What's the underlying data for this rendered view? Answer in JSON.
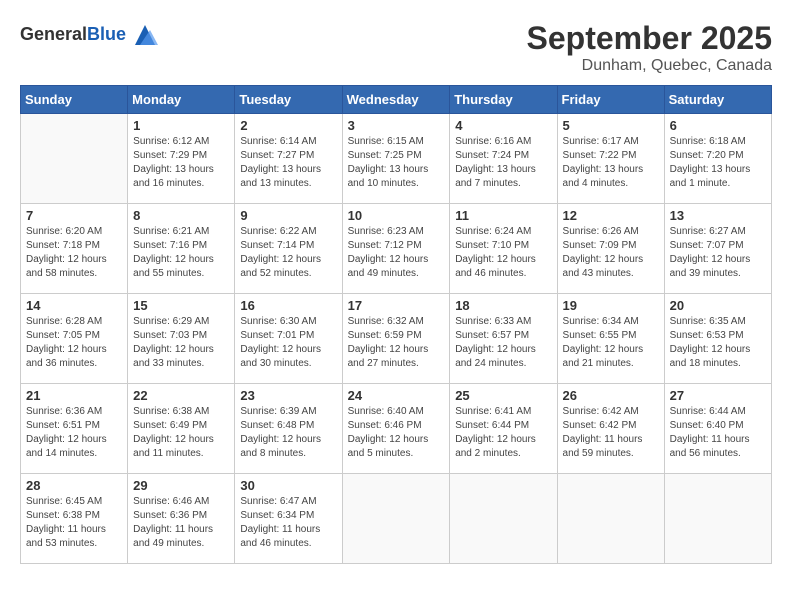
{
  "header": {
    "logo_general": "General",
    "logo_blue": "Blue",
    "month": "September 2025",
    "location": "Dunham, Quebec, Canada"
  },
  "days_of_week": [
    "Sunday",
    "Monday",
    "Tuesday",
    "Wednesday",
    "Thursday",
    "Friday",
    "Saturday"
  ],
  "weeks": [
    [
      {
        "day": "",
        "info": ""
      },
      {
        "day": "1",
        "info": "Sunrise: 6:12 AM\nSunset: 7:29 PM\nDaylight: 13 hours\nand 16 minutes."
      },
      {
        "day": "2",
        "info": "Sunrise: 6:14 AM\nSunset: 7:27 PM\nDaylight: 13 hours\nand 13 minutes."
      },
      {
        "day": "3",
        "info": "Sunrise: 6:15 AM\nSunset: 7:25 PM\nDaylight: 13 hours\nand 10 minutes."
      },
      {
        "day": "4",
        "info": "Sunrise: 6:16 AM\nSunset: 7:24 PM\nDaylight: 13 hours\nand 7 minutes."
      },
      {
        "day": "5",
        "info": "Sunrise: 6:17 AM\nSunset: 7:22 PM\nDaylight: 13 hours\nand 4 minutes."
      },
      {
        "day": "6",
        "info": "Sunrise: 6:18 AM\nSunset: 7:20 PM\nDaylight: 13 hours\nand 1 minute."
      }
    ],
    [
      {
        "day": "7",
        "info": "Sunrise: 6:20 AM\nSunset: 7:18 PM\nDaylight: 12 hours\nand 58 minutes."
      },
      {
        "day": "8",
        "info": "Sunrise: 6:21 AM\nSunset: 7:16 PM\nDaylight: 12 hours\nand 55 minutes."
      },
      {
        "day": "9",
        "info": "Sunrise: 6:22 AM\nSunset: 7:14 PM\nDaylight: 12 hours\nand 52 minutes."
      },
      {
        "day": "10",
        "info": "Sunrise: 6:23 AM\nSunset: 7:12 PM\nDaylight: 12 hours\nand 49 minutes."
      },
      {
        "day": "11",
        "info": "Sunrise: 6:24 AM\nSunset: 7:10 PM\nDaylight: 12 hours\nand 46 minutes."
      },
      {
        "day": "12",
        "info": "Sunrise: 6:26 AM\nSunset: 7:09 PM\nDaylight: 12 hours\nand 43 minutes."
      },
      {
        "day": "13",
        "info": "Sunrise: 6:27 AM\nSunset: 7:07 PM\nDaylight: 12 hours\nand 39 minutes."
      }
    ],
    [
      {
        "day": "14",
        "info": "Sunrise: 6:28 AM\nSunset: 7:05 PM\nDaylight: 12 hours\nand 36 minutes."
      },
      {
        "day": "15",
        "info": "Sunrise: 6:29 AM\nSunset: 7:03 PM\nDaylight: 12 hours\nand 33 minutes."
      },
      {
        "day": "16",
        "info": "Sunrise: 6:30 AM\nSunset: 7:01 PM\nDaylight: 12 hours\nand 30 minutes."
      },
      {
        "day": "17",
        "info": "Sunrise: 6:32 AM\nSunset: 6:59 PM\nDaylight: 12 hours\nand 27 minutes."
      },
      {
        "day": "18",
        "info": "Sunrise: 6:33 AM\nSunset: 6:57 PM\nDaylight: 12 hours\nand 24 minutes."
      },
      {
        "day": "19",
        "info": "Sunrise: 6:34 AM\nSunset: 6:55 PM\nDaylight: 12 hours\nand 21 minutes."
      },
      {
        "day": "20",
        "info": "Sunrise: 6:35 AM\nSunset: 6:53 PM\nDaylight: 12 hours\nand 18 minutes."
      }
    ],
    [
      {
        "day": "21",
        "info": "Sunrise: 6:36 AM\nSunset: 6:51 PM\nDaylight: 12 hours\nand 14 minutes."
      },
      {
        "day": "22",
        "info": "Sunrise: 6:38 AM\nSunset: 6:49 PM\nDaylight: 12 hours\nand 11 minutes."
      },
      {
        "day": "23",
        "info": "Sunrise: 6:39 AM\nSunset: 6:48 PM\nDaylight: 12 hours\nand 8 minutes."
      },
      {
        "day": "24",
        "info": "Sunrise: 6:40 AM\nSunset: 6:46 PM\nDaylight: 12 hours\nand 5 minutes."
      },
      {
        "day": "25",
        "info": "Sunrise: 6:41 AM\nSunset: 6:44 PM\nDaylight: 12 hours\nand 2 minutes."
      },
      {
        "day": "26",
        "info": "Sunrise: 6:42 AM\nSunset: 6:42 PM\nDaylight: 11 hours\nand 59 minutes."
      },
      {
        "day": "27",
        "info": "Sunrise: 6:44 AM\nSunset: 6:40 PM\nDaylight: 11 hours\nand 56 minutes."
      }
    ],
    [
      {
        "day": "28",
        "info": "Sunrise: 6:45 AM\nSunset: 6:38 PM\nDaylight: 11 hours\nand 53 minutes."
      },
      {
        "day": "29",
        "info": "Sunrise: 6:46 AM\nSunset: 6:36 PM\nDaylight: 11 hours\nand 49 minutes."
      },
      {
        "day": "30",
        "info": "Sunrise: 6:47 AM\nSunset: 6:34 PM\nDaylight: 11 hours\nand 46 minutes."
      },
      {
        "day": "",
        "info": ""
      },
      {
        "day": "",
        "info": ""
      },
      {
        "day": "",
        "info": ""
      },
      {
        "day": "",
        "info": ""
      }
    ]
  ]
}
